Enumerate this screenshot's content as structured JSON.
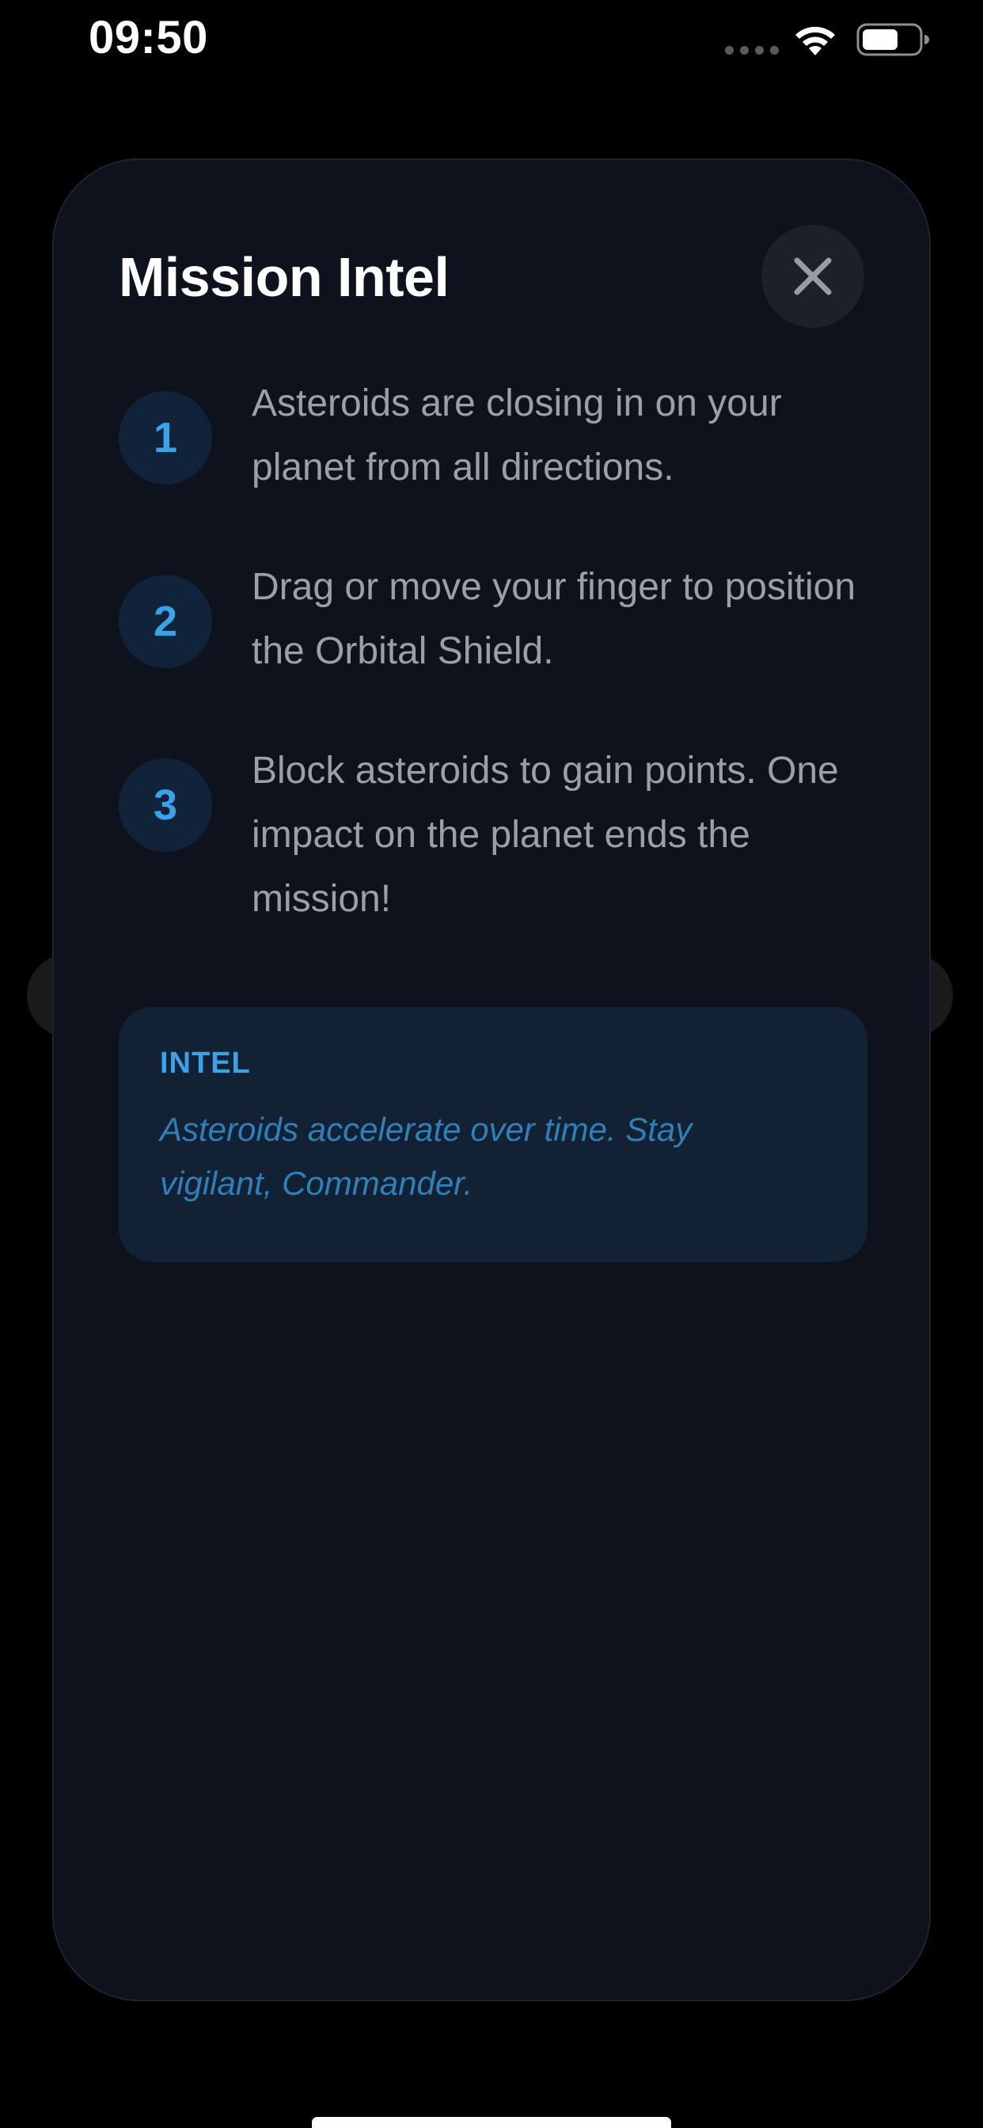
{
  "status_bar": {
    "time": "09:50",
    "icons": [
      "signal-dots-icon",
      "wifi-icon",
      "battery-icon"
    ]
  },
  "modal": {
    "title": "Mission Intel",
    "close_icon": "close-icon",
    "steps": [
      {
        "number": "1",
        "text": "Asteroids are closing in on your planet from all directions."
      },
      {
        "number": "2",
        "text": "Drag or move your finger to position the Orbital Shield."
      },
      {
        "number": "3",
        "text": "Block asteroids to gain points. One impact on the planet ends the mission!"
      }
    ],
    "intel": {
      "label": "INTEL",
      "text": "Asteroids accelerate over time. Stay vigilant, Commander."
    }
  },
  "colors": {
    "background": "#000000",
    "card": "#0e121c",
    "accent": "#3aa2e8",
    "body_text": "#9aa0ab",
    "intel_box": "#122133"
  }
}
